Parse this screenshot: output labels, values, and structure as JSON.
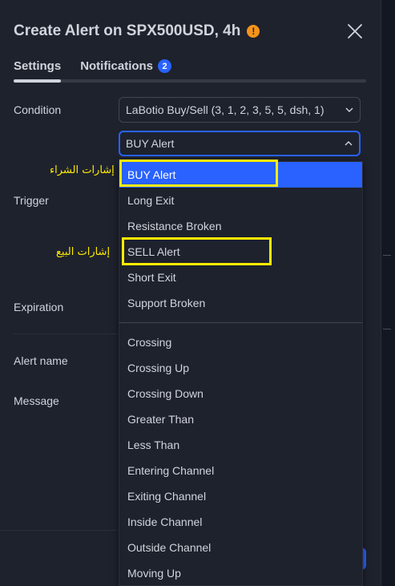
{
  "dialog": {
    "title": "Create Alert on SPX500USD, 4h",
    "warning_icon_glyph": "!"
  },
  "tabs": [
    {
      "label": "Settings"
    },
    {
      "label": "Notifications",
      "badge": "2"
    }
  ],
  "form": {
    "condition_label": "Condition",
    "condition_value": "LaBotio Buy/Sell (3, 1, 2, 3, 5, 5, dsh, 1)",
    "alert_type_value": "BUY Alert",
    "trigger_label": "Trigger",
    "expiration_label": "Expiration",
    "alert_name_label": "Alert name",
    "message_label": "Message"
  },
  "dropdown": {
    "signal_options": [
      "BUY Alert",
      "Long Exit",
      "Resistance Broken",
      "SELL Alert",
      "Short Exit",
      "Support Broken"
    ],
    "selected_option": "BUY Alert",
    "operator_options": [
      "Crossing",
      "Crossing Up",
      "Crossing Down",
      "Greater Than",
      "Less Than",
      "Entering Channel",
      "Exiting Channel",
      "Inside Channel",
      "Outside Channel",
      "Moving Up"
    ]
  },
  "annotations": {
    "buy_signals": "إشارات الشراء",
    "sell_signals": "إشارات البيع",
    "highlight_color": "#ffeb00"
  },
  "colors": {
    "accent": "#2962ff",
    "background": "#1e222d",
    "warning": "#f7931a"
  }
}
